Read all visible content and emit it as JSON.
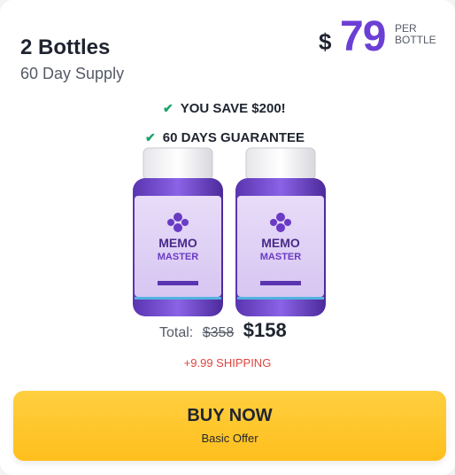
{
  "offer": {
    "title": "2 Bottles",
    "subtitle": "60 Day Supply",
    "price": {
      "currency": "$",
      "value": "79",
      "unit_line1": "PER",
      "unit_line2": "BOTTLE"
    },
    "benefits": [
      "YOU SAVE $200!",
      "60 DAYS GUARANTEE"
    ],
    "product": {
      "brand_line1": "MEMO",
      "brand_line2": "MASTER"
    },
    "total": {
      "label": "Total:",
      "old_price": "$358",
      "new_price": "$158"
    },
    "shipping": "+9.99 SHIPPING",
    "cta": {
      "label": "BUY NOW",
      "sublabel": "Basic Offer"
    }
  },
  "colors": {
    "accent": "#6b3fd4",
    "cta": "#ffc52e",
    "shipping": "#e0463f",
    "check": "#1aa36b"
  }
}
